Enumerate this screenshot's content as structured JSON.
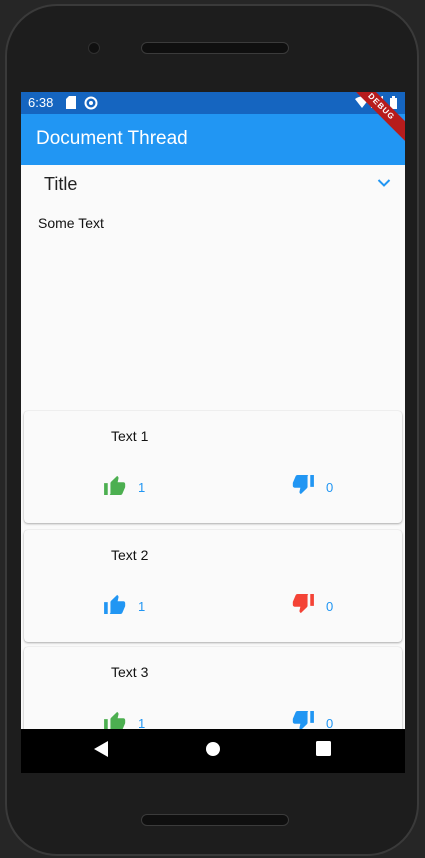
{
  "status_bar": {
    "time": "6:38",
    "icons": [
      "sd-card-icon",
      "data-saver-icon",
      "wifi-icon",
      "signal-icon",
      "battery-icon"
    ]
  },
  "debug_banner": "DEBUG",
  "app_bar": {
    "title": "Document Thread"
  },
  "expansion": {
    "title": "Title",
    "body": "Some Text"
  },
  "cards": [
    {
      "text": "Text 1",
      "likes": "1",
      "dislikes": "0",
      "like_color": "#4caf50",
      "dislike_color": "#2196f3"
    },
    {
      "text": "Text 2",
      "likes": "1",
      "dislikes": "0",
      "like_color": "#2196f3",
      "dislike_color": "#f44336"
    },
    {
      "text": "Text 3",
      "likes": "1",
      "dislikes": "0",
      "like_color": "#4caf50",
      "dislike_color": "#2196f3"
    }
  ],
  "colors": {
    "primary": "#2196f3",
    "status_bar": "#1565c0",
    "background": "#fafafa"
  },
  "nav_bar": {
    "icons": [
      "back-icon",
      "home-icon",
      "recents-icon"
    ]
  }
}
